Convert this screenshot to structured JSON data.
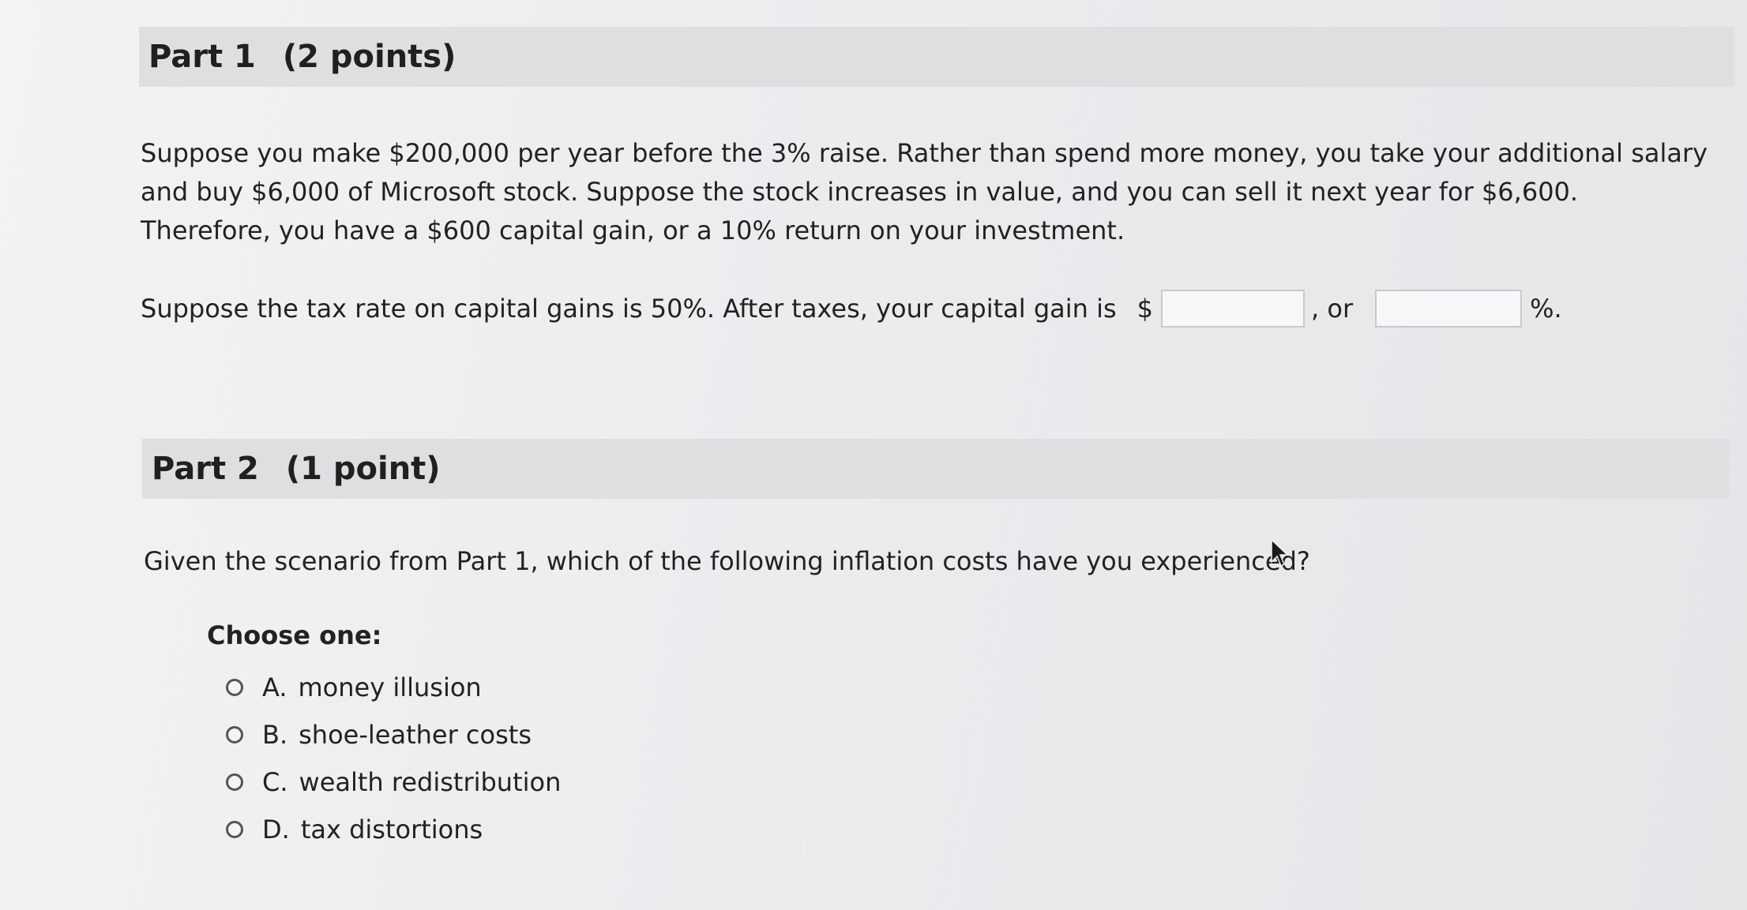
{
  "part1": {
    "title": "Part 1",
    "points": "(2 points)",
    "scenario": "Suppose you make $200,000 per year before the 3% raise. Rather than spend more money, you take your additional salary and buy $6,000 of Microsoft stock. Suppose the stock increases in value, and you can sell it next year for $6,600. Therefore, you have a $600 capital gain, or a 10% return on your investment.",
    "tax_prompt": "Suppose the tax rate on capital gains is 50%. After taxes, your capital gain is",
    "currency_symbol": "$",
    "connector": ", or",
    "percent_suffix": "%.",
    "dollar_answer": "",
    "percent_answer": ""
  },
  "part2": {
    "title": "Part 2",
    "points": "(1 point)",
    "question": "Given the scenario from Part 1, which of the following inflation costs have you experienced?",
    "choose_label": "Choose one:",
    "options": [
      {
        "letter": "A.",
        "label": "money illusion"
      },
      {
        "letter": "B.",
        "label": "shoe-leather costs"
      },
      {
        "letter": "C.",
        "label": "wealth redistribution"
      },
      {
        "letter": "D.",
        "label": "tax distortions"
      }
    ]
  },
  "cursor": {
    "icon": "mouse-pointer-icon"
  }
}
